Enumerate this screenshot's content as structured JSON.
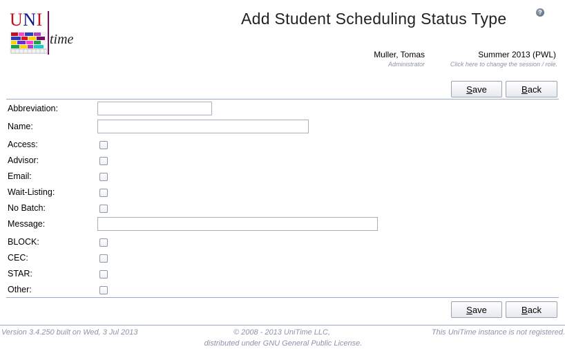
{
  "logo": {
    "letters": [
      "U",
      "N",
      "I"
    ],
    "word": "time"
  },
  "header": {
    "title": "Add Student Scheduling Status Type",
    "help_icon": "help-question-icon"
  },
  "user": {
    "name": "Muller, Tomas",
    "role": "Administrator"
  },
  "session": {
    "name": "Summer 2013 (PWL)",
    "hint": "Click here to change the session / role."
  },
  "buttons": {
    "save_accel": "S",
    "save_rest": "ave",
    "back_accel": "B",
    "back_rest": "ack"
  },
  "form": {
    "abbreviation_label": "Abbreviation:",
    "abbreviation_value": "",
    "name_label": "Name:",
    "name_value": "",
    "access_label": "Access:",
    "advisor_label": "Advisor:",
    "email_label": "Email:",
    "waitlisting_label": "Wait-Listing:",
    "nobatch_label": "No Batch:",
    "message_label": "Message:",
    "message_value": "",
    "block_label": "BLOCK:",
    "cec_label": "CEC:",
    "star_label": "STAR:",
    "other_label": "Other:",
    "checkboxes_checked": {
      "access": false,
      "advisor": false,
      "email": false,
      "waitlisting": false,
      "nobatch": false,
      "block": false,
      "cec": false,
      "star": false,
      "other": false
    }
  },
  "footer": {
    "version": "Version 3.4.250 built on Wed, 3 Jul 2013",
    "copyright": "© 2008 - 2013 UniTime LLC,",
    "license": "distributed under GNU General Public License.",
    "registration": "This UniTime instance is not registered."
  }
}
